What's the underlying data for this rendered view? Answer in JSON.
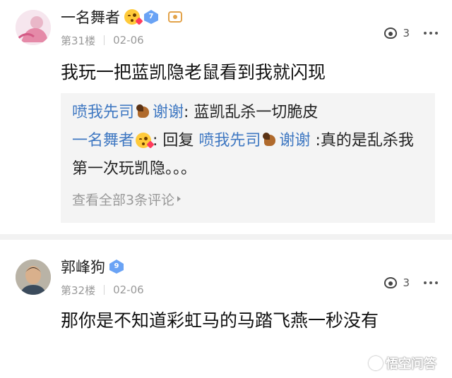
{
  "comments": [
    {
      "username": "一名舞者",
      "level": "7",
      "floor": "第31楼",
      "date": "02-06",
      "likes": "3",
      "text": "我玩一把蓝凯隐老鼠看到我就闪现",
      "replies": [
        {
          "author": "喷我先司",
          "author_suffix": "谢谢",
          "content": ": 蓝凯乱杀一切脆皮"
        },
        {
          "author": "一名舞者",
          "prefix": ": 回复 ",
          "target": "喷我先司",
          "target_suffix": "谢谢",
          "content": " :真的是乱杀我第一次玩凯隐。。。"
        }
      ],
      "view_all": "查看全部3条评论"
    },
    {
      "username": "郭峰狗",
      "level": "9",
      "floor": "第32楼",
      "date": "02-06",
      "likes": "3",
      "text": "那你是不知道彩虹马的马踏飞燕一秒没有"
    }
  ],
  "watermark": "悟空问答",
  "colors": {
    "link": "#3f78c2",
    "badge": "#6aa3f5",
    "meta": "#999999"
  }
}
